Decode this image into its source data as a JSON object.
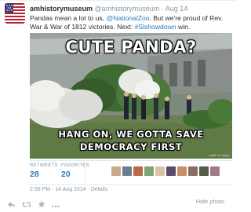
{
  "tweet": {
    "name": "amhistorymuseum",
    "handle": "@amhistorymuseum",
    "separator": "·",
    "date": "Aug 14",
    "text_part1": "Pandas mean a lot to us, ",
    "mention": "@NationalZoo",
    "text_part2": ". But we're proud of Rev. War & War of 1812 victories. Next: ",
    "hashtag": "#Slshowdown",
    "text_part3": " win."
  },
  "photo": {
    "top_text": "CUTE PANDA?",
    "bottom_text_1": "HANG ON, WE GOTTA SAVE",
    "bottom_text_2": "DEMOCRACY FIRST",
    "credit": "made on imgur"
  },
  "stats": {
    "retweets_label": "RETWEETS",
    "retweets_count": "28",
    "favorites_label": "FAVORITES",
    "favorites_count": "20"
  },
  "timestamp": "2:58 PM - 14 Aug 2014 · Details",
  "actions": {
    "reply_icon": "reply-icon",
    "retweet_icon": "retweet-icon",
    "favorite_icon": "star-icon",
    "more_icon": "more-icon",
    "hide_photo": "Hide photo"
  },
  "colors": {
    "link": "#2b7bb9",
    "muted": "#8899a6",
    "text": "#292f33"
  }
}
